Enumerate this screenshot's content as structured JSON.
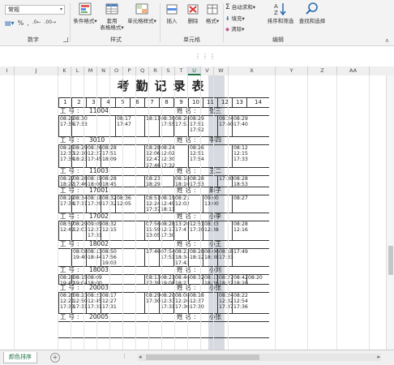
{
  "ribbon": {
    "number_format": "常规",
    "number_symbols": [
      "%",
      ","
    ],
    "groups": {
      "number": "数字",
      "styles": "样式",
      "cells": "单元格",
      "editing": "编辑"
    },
    "buttons": {
      "conditional": "条件格式",
      "table1": "套用",
      "table2": "表格格式",
      "cellstyle": "单元格样式",
      "insert": "插入",
      "delete": "删除",
      "format": "格式",
      "autosum": "自动求和",
      "fill": "填充",
      "clear": "清除",
      "sort": "排序和筛选",
      "find": "查找和选择"
    },
    "icons": [
      "conditional-format-icon",
      "table-format-icon",
      "cell-styles-icon",
      "insert-icon",
      "delete-icon",
      "format-icon",
      "sigma-icon",
      "fill-down-icon",
      "eraser-icon",
      "sort-filter-icon",
      "find-icon"
    ]
  },
  "column_headers": [
    "I",
    "J",
    "K",
    "L",
    "M",
    "N",
    "O",
    "P",
    "Q",
    "R",
    "S",
    "T",
    "U",
    "V",
    "W",
    "X",
    "Y",
    "Z",
    "AA"
  ],
  "selected_column": "U",
  "sheet": {
    "title": "考勤记录表",
    "day_numbers": [
      "1",
      "2",
      "3",
      "4",
      "5",
      "6",
      "7",
      "8",
      "9",
      "10",
      "11",
      "12",
      "13",
      "14"
    ],
    "id_label": "工号:",
    "name_label": "姓名:",
    "employees": [
      {
        "id": "11004",
        "name": "张三",
        "cells": [
          {
            "d": 1,
            "t": "08:29\n17:34"
          },
          {
            "d": 2,
            "t": "08:30\n17:33"
          },
          {
            "d": 5,
            "t": "08:17\n17:47"
          },
          {
            "d": 7,
            "t": "18:11"
          },
          {
            "d": 8,
            "t": "08:30\n17:55"
          },
          {
            "d": 9,
            "t": "08:28\n17:53"
          },
          {
            "d": 10,
            "t": "08:29\n17:51\n17:52"
          },
          {
            "d": 12,
            "t": "08:24\n17:40"
          },
          {
            "d": 13,
            "t": "08:29\n17:40"
          }
        ]
      },
      {
        "id": "3010",
        "name": "李四",
        "cells": [
          {
            "d": 1,
            "t": "08:25\n12:30\n17:34"
          },
          {
            "d": 2,
            "t": "08:29\n12:10\n18:23"
          },
          {
            "d": 3,
            "t": "08:26\n12:27\n17:45"
          },
          {
            "d": 4,
            "t": "08:28\n17:51\n18:09"
          },
          {
            "d": 7,
            "t": "08:28\n12:06\n12:47\n17:46"
          },
          {
            "d": 8,
            "t": "08:24\n12:02\n12:30\n17:32"
          },
          {
            "d": 10,
            "t": "08:26\n12:51\n17:54"
          },
          {
            "d": 13,
            "t": "08:12\n12:15\n17:33"
          }
        ]
      },
      {
        "id": "11003",
        "name": "王二",
        "cells": [
          {
            "d": 1,
            "t": "08:27\n18:22"
          },
          {
            "d": 2,
            "t": "08:28\n17:46"
          },
          {
            "d": 3,
            "t": "08:19\n18:00"
          },
          {
            "d": 4,
            "t": "08:28\n18:45"
          },
          {
            "d": 7,
            "t": "08:23\n18:29"
          },
          {
            "d": 9,
            "t": "08:18\n18:10"
          },
          {
            "d": 10,
            "t": "08:28\n17:53"
          },
          {
            "d": 12,
            "t": "17:30"
          },
          {
            "d": 13,
            "t": "08:28\n18:53"
          }
        ]
      },
      {
        "id": "17001",
        "name": "麻子",
        "cells": [
          {
            "d": 1,
            "t": "08:29\n17:34"
          },
          {
            "d": 2,
            "t": "08:34\n17:31"
          },
          {
            "d": 3,
            "t": "08:18\n17:29"
          },
          {
            "d": 4,
            "t": "08:32\n17:32"
          },
          {
            "d": 5,
            "t": "08:36\n12:05"
          },
          {
            "d": 7,
            "t": "08:51\n12:24\n17:37"
          },
          {
            "d": 8,
            "t": "08:19\n12:49\n18:11"
          },
          {
            "d": 9,
            "t": "08:21\n12:02"
          },
          {
            "d": 11,
            "t": "09:00\n13:00"
          },
          {
            "d": 13,
            "t": "08:27"
          }
        ]
      },
      {
        "id": "17002",
        "name": "小李",
        "cells": [
          {
            "d": 1,
            "t": "08:57\n12:42"
          },
          {
            "d": 2,
            "t": "08:29\n12:03"
          },
          {
            "d": 3,
            "t": "09:09\n12:27\n17:31"
          },
          {
            "d": 4,
            "t": "08:32\n12:15"
          },
          {
            "d": 7,
            "t": "07:56\n11:59\n13:05"
          },
          {
            "d": 8,
            "t": "08:28\n12:17\n17:30"
          },
          {
            "d": 9,
            "t": "13:20\n17:47"
          },
          {
            "d": 10,
            "t": "12:51\n17:30"
          },
          {
            "d": 11,
            "t": "08:33\n12:38"
          },
          {
            "d": 13,
            "t": "08:28\n12:16"
          }
        ]
      },
      {
        "id": "18002",
        "name": "小王",
        "cells": [
          {
            "d": 2,
            "t": "08:08\n19:40"
          },
          {
            "d": 3,
            "t": "08:13\n18:44"
          },
          {
            "d": 4,
            "t": "08:50\n17:56\n19:03"
          },
          {
            "d": 7,
            "t": "17:46"
          },
          {
            "d": 8,
            "t": "07:54\n17:51"
          },
          {
            "d": 9,
            "t": "08:22\n18:34\n17:42"
          },
          {
            "d": 10,
            "t": "08:28\n18:12"
          },
          {
            "d": 11,
            "t": "08:06\n18:38"
          },
          {
            "d": 12,
            "t": "08:18\n17:33"
          },
          {
            "d": 13,
            "t": "17:49"
          }
        ]
      },
      {
        "id": "18003",
        "name": "小刘",
        "cells": [
          {
            "d": 1,
            "t": "08:26\n19:40"
          },
          {
            "d": 2,
            "t": "08:15\n19:04"
          },
          {
            "d": 3,
            "t": "08:09\n18:00"
          },
          {
            "d": 7,
            "t": "08:13\n17:39"
          },
          {
            "d": 8,
            "t": "08:21\n19:08"
          },
          {
            "d": 9,
            "t": "08:46\n18:27"
          },
          {
            "d": 10,
            "t": "08:32"
          },
          {
            "d": 11,
            "t": "08:13\n18:26"
          },
          {
            "d": 12,
            "t": "08:27\n18:22"
          },
          {
            "d": 13,
            "t": "08:42\n18:20"
          },
          {
            "d": 14,
            "t": "08:20"
          }
        ]
      },
      {
        "id": "20003",
        "name": "小张",
        "cells": [
          {
            "d": 1,
            "t": "08:23\n12:21\n17:33"
          },
          {
            "d": 2,
            "t": "08:23\n12:50\n17:31"
          },
          {
            "d": 3,
            "t": "08:23\n12:45\n17:31"
          },
          {
            "d": 4,
            "t": "08:17\n12:27\n17:31"
          },
          {
            "d": 7,
            "t": "08:29\n17:30"
          },
          {
            "d": 8,
            "t": "08:20\n12:33\n17:31"
          },
          {
            "d": 9,
            "t": "08:08\n12:26\n17:30"
          },
          {
            "d": 10,
            "t": "08:18\n12:37\n17:30"
          },
          {
            "d": 12,
            "t": "08:24\n12:32\n17:37"
          },
          {
            "d": 13,
            "t": "08:22\n12:54\n17:36"
          }
        ]
      },
      {
        "id": "20005",
        "name": "小张",
        "cells": []
      }
    ]
  },
  "sheet_tab": "颜色排序"
}
